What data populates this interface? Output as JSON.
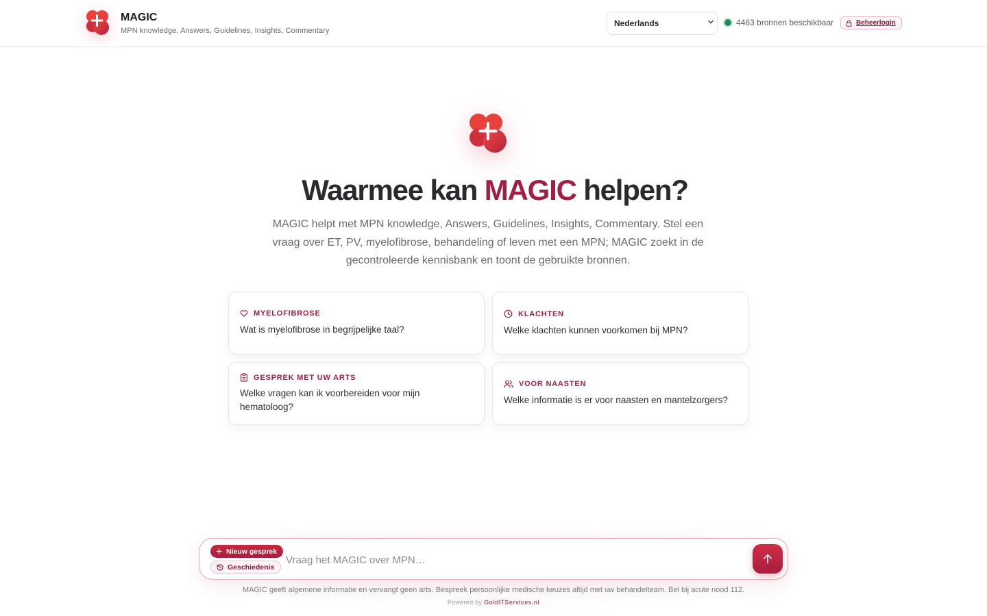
{
  "header": {
    "app_title": "MAGIC",
    "app_subtitle": "MPN knowledge, Answers, Guidelines, Insights, Commentary",
    "language": {
      "selected": "Nederlands",
      "options": [
        "Nederlands"
      ]
    },
    "status_text": "4463 bronnen beschikbaar",
    "admin_login": "Beheerlogin"
  },
  "hero": {
    "title_before": "Waarmee kan ",
    "title_accent": "MAGIC",
    "title_after": " helpen?",
    "description": "MAGIC helpt met MPN knowledge, Answers, Guidelines, Insights, Commentary. Stel een vraag over ET, PV, myelofibrose, behandeling of leven met een MPN; MAGIC zoekt in de gecontroleerde kennisbank en toont de gebruikte bronnen."
  },
  "suggestions": [
    {
      "tag": "MYELOFIBROSE",
      "icon": "heart-icon",
      "question": "Wat is myelofibrose in begrijpelijke taal?"
    },
    {
      "tag": "KLACHTEN",
      "icon": "clock-icon",
      "question": "Welke klachten kunnen voorkomen bij MPN?"
    },
    {
      "tag": "GESPREK MET UW ARTS",
      "icon": "clipboard-icon",
      "question": "Welke vragen kan ik voorbereiden voor mijn hematoloog?"
    },
    {
      "tag": "VOOR NAASTEN",
      "icon": "users-icon",
      "question": "Welke informatie is er voor naasten en mantelzorgers?"
    }
  ],
  "composer": {
    "new_chat": "Nieuw gesprek",
    "history": "Geschiedenis",
    "placeholder": "Vraag het MAGIC over MPN…",
    "value": ""
  },
  "footer": {
    "disclaimer": "MAGIC geeft algemene informatie en vervangt geen arts. Bespreek persoonlijke medische keuzes altijd met uw behandelteam. Bel bij acute nood 112.",
    "powered_prefix": "Powered by ",
    "powered_brand": "GoldITServices.nl"
  },
  "colors": {
    "accent": "#a11e45",
    "brand_red": "#c8283f",
    "status_green": "#1f8a5b"
  }
}
